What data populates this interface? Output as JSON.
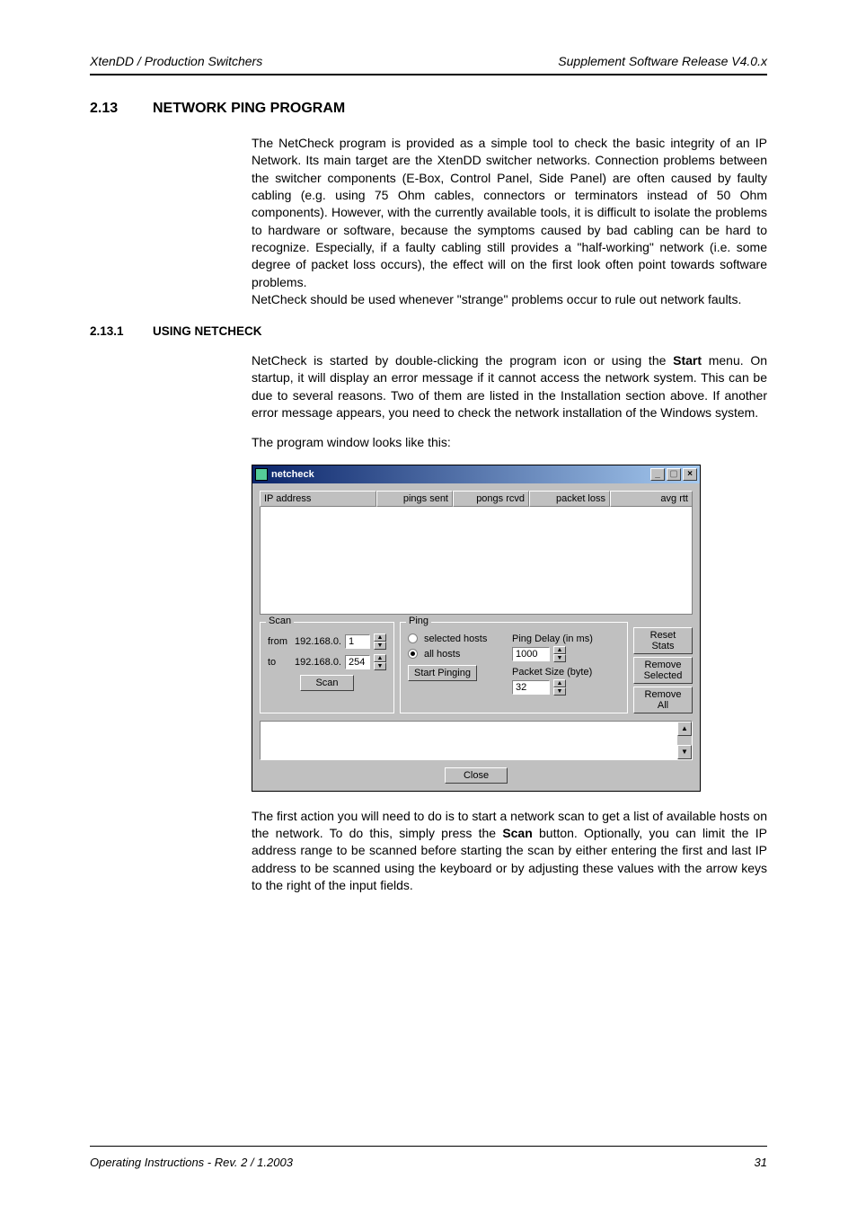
{
  "header": {
    "left": "XtenDD / Production Switchers",
    "right": "Supplement Software Release V4.0.x"
  },
  "section": {
    "num": "2.13",
    "title": "NETWORK PING PROGRAM"
  },
  "p1": "The NetCheck program is provided as a simple tool to check the basic integrity of an IP Network. Its main target are the XtenDD switcher networks. Connection problems between the switcher components (E-Box, Control Panel, Side Panel) are often caused by faulty cabling (e.g. using 75 Ohm cables, connectors or terminators instead of 50 Ohm components). However, with the currently available tools, it is difficult to isolate the problems to hardware or software, because the symptoms caused by bad cabling can be hard to recognize. Especially, if a faulty cabling still provides a \"half-working\" network (i.e. some degree of packet loss occurs), the effect will on the first look often point towards software problems.",
  "p1b": "NetCheck should be used whenever \"strange\" problems occur to rule out network faults.",
  "subsection": {
    "num": "2.13.1",
    "title": "USING NETCHECK"
  },
  "p2a": "NetCheck is started by double-clicking the program icon or using the ",
  "p2_bold": "Start",
  "p2b": " menu. On startup, it will display an error message if it cannot access the network system. This can be due to several reasons. Two of them are listed in the Installation section above. If another error message appears, you need to check the network installation of the Windows system.",
  "p3": "The program window looks like this:",
  "window": {
    "title": "netcheck",
    "cols": {
      "c1": "IP address",
      "c2": "pings sent",
      "c3": "pongs rcvd",
      "c4": "packet loss",
      "c5": "avg rtt"
    },
    "scan": {
      "legend": "Scan",
      "from_lbl": "from",
      "from_prefix": "192.168.0.",
      "from_val": "1",
      "to_lbl": "to",
      "to_prefix": "192.168.0.",
      "to_val": "254",
      "scan_btn": "Scan"
    },
    "ping": {
      "legend": "Ping",
      "opt_selected": "selected hosts",
      "opt_all": "all hosts",
      "start_btn": "Start Pinging",
      "delay_lbl": "Ping Delay (in ms)",
      "delay_val": "1000",
      "size_lbl": "Packet Size (byte)",
      "size_val": "32"
    },
    "buttons": {
      "reset": "Reset Stats",
      "remove_sel": "Remove Selected",
      "remove_all": "Remove All"
    },
    "close": "Close"
  },
  "p4a": "The first action you will need to do is to start a network scan to get a list of available hosts on the network. To do this, simply press the ",
  "p4_bold": "Scan",
  "p4b": " button. Optionally, you can limit the IP address range to be scanned before starting the scan by either entering the first and last IP address to be scanned using the keyboard or by adjusting these values with the arrow keys to the right of the input fields.",
  "footer": {
    "left": "Operating Instructions - Rev. 2 / 1.2003",
    "right": "31"
  }
}
